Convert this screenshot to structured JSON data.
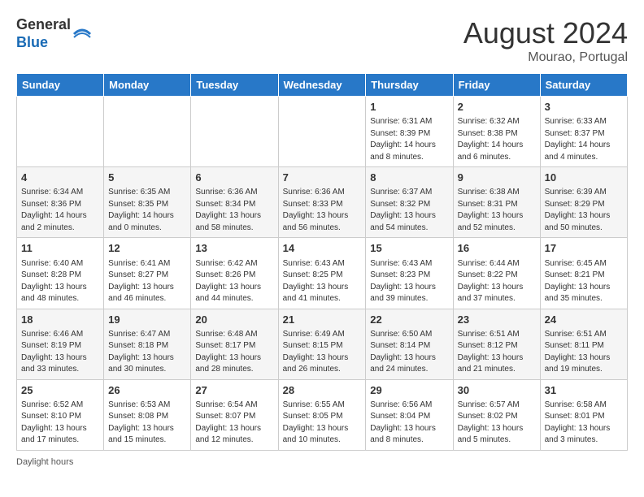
{
  "header": {
    "logo_line1": "General",
    "logo_line2": "Blue",
    "month_title": "August 2024",
    "subtitle": "Mourao, Portugal"
  },
  "days_of_week": [
    "Sunday",
    "Monday",
    "Tuesday",
    "Wednesday",
    "Thursday",
    "Friday",
    "Saturday"
  ],
  "weeks": [
    [
      {
        "num": "",
        "info": ""
      },
      {
        "num": "",
        "info": ""
      },
      {
        "num": "",
        "info": ""
      },
      {
        "num": "",
        "info": ""
      },
      {
        "num": "1",
        "info": "Sunrise: 6:31 AM\nSunset: 8:39 PM\nDaylight: 14 hours\nand 8 minutes."
      },
      {
        "num": "2",
        "info": "Sunrise: 6:32 AM\nSunset: 8:38 PM\nDaylight: 14 hours\nand 6 minutes."
      },
      {
        "num": "3",
        "info": "Sunrise: 6:33 AM\nSunset: 8:37 PM\nDaylight: 14 hours\nand 4 minutes."
      }
    ],
    [
      {
        "num": "4",
        "info": "Sunrise: 6:34 AM\nSunset: 8:36 PM\nDaylight: 14 hours\nand 2 minutes."
      },
      {
        "num": "5",
        "info": "Sunrise: 6:35 AM\nSunset: 8:35 PM\nDaylight: 14 hours\nand 0 minutes."
      },
      {
        "num": "6",
        "info": "Sunrise: 6:36 AM\nSunset: 8:34 PM\nDaylight: 13 hours\nand 58 minutes."
      },
      {
        "num": "7",
        "info": "Sunrise: 6:36 AM\nSunset: 8:33 PM\nDaylight: 13 hours\nand 56 minutes."
      },
      {
        "num": "8",
        "info": "Sunrise: 6:37 AM\nSunset: 8:32 PM\nDaylight: 13 hours\nand 54 minutes."
      },
      {
        "num": "9",
        "info": "Sunrise: 6:38 AM\nSunset: 8:31 PM\nDaylight: 13 hours\nand 52 minutes."
      },
      {
        "num": "10",
        "info": "Sunrise: 6:39 AM\nSunset: 8:29 PM\nDaylight: 13 hours\nand 50 minutes."
      }
    ],
    [
      {
        "num": "11",
        "info": "Sunrise: 6:40 AM\nSunset: 8:28 PM\nDaylight: 13 hours\nand 48 minutes."
      },
      {
        "num": "12",
        "info": "Sunrise: 6:41 AM\nSunset: 8:27 PM\nDaylight: 13 hours\nand 46 minutes."
      },
      {
        "num": "13",
        "info": "Sunrise: 6:42 AM\nSunset: 8:26 PM\nDaylight: 13 hours\nand 44 minutes."
      },
      {
        "num": "14",
        "info": "Sunrise: 6:43 AM\nSunset: 8:25 PM\nDaylight: 13 hours\nand 41 minutes."
      },
      {
        "num": "15",
        "info": "Sunrise: 6:43 AM\nSunset: 8:23 PM\nDaylight: 13 hours\nand 39 minutes."
      },
      {
        "num": "16",
        "info": "Sunrise: 6:44 AM\nSunset: 8:22 PM\nDaylight: 13 hours\nand 37 minutes."
      },
      {
        "num": "17",
        "info": "Sunrise: 6:45 AM\nSunset: 8:21 PM\nDaylight: 13 hours\nand 35 minutes."
      }
    ],
    [
      {
        "num": "18",
        "info": "Sunrise: 6:46 AM\nSunset: 8:19 PM\nDaylight: 13 hours\nand 33 minutes."
      },
      {
        "num": "19",
        "info": "Sunrise: 6:47 AM\nSunset: 8:18 PM\nDaylight: 13 hours\nand 30 minutes."
      },
      {
        "num": "20",
        "info": "Sunrise: 6:48 AM\nSunset: 8:17 PM\nDaylight: 13 hours\nand 28 minutes."
      },
      {
        "num": "21",
        "info": "Sunrise: 6:49 AM\nSunset: 8:15 PM\nDaylight: 13 hours\nand 26 minutes."
      },
      {
        "num": "22",
        "info": "Sunrise: 6:50 AM\nSunset: 8:14 PM\nDaylight: 13 hours\nand 24 minutes."
      },
      {
        "num": "23",
        "info": "Sunrise: 6:51 AM\nSunset: 8:12 PM\nDaylight: 13 hours\nand 21 minutes."
      },
      {
        "num": "24",
        "info": "Sunrise: 6:51 AM\nSunset: 8:11 PM\nDaylight: 13 hours\nand 19 minutes."
      }
    ],
    [
      {
        "num": "25",
        "info": "Sunrise: 6:52 AM\nSunset: 8:10 PM\nDaylight: 13 hours\nand 17 minutes."
      },
      {
        "num": "26",
        "info": "Sunrise: 6:53 AM\nSunset: 8:08 PM\nDaylight: 13 hours\nand 15 minutes."
      },
      {
        "num": "27",
        "info": "Sunrise: 6:54 AM\nSunset: 8:07 PM\nDaylight: 13 hours\nand 12 minutes."
      },
      {
        "num": "28",
        "info": "Sunrise: 6:55 AM\nSunset: 8:05 PM\nDaylight: 13 hours\nand 10 minutes."
      },
      {
        "num": "29",
        "info": "Sunrise: 6:56 AM\nSunset: 8:04 PM\nDaylight: 13 hours\nand 8 minutes."
      },
      {
        "num": "30",
        "info": "Sunrise: 6:57 AM\nSunset: 8:02 PM\nDaylight: 13 hours\nand 5 minutes."
      },
      {
        "num": "31",
        "info": "Sunrise: 6:58 AM\nSunset: 8:01 PM\nDaylight: 13 hours\nand 3 minutes."
      }
    ]
  ],
  "footer_text": "Daylight hours"
}
